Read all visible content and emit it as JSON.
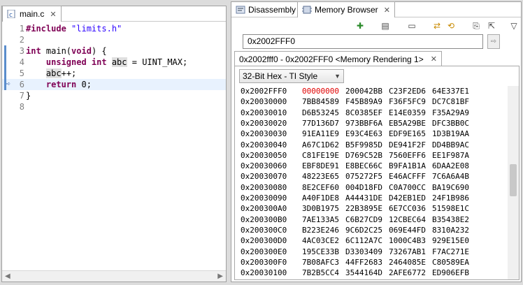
{
  "editor": {
    "tab_label": "main.c",
    "tab_icon": "c-file-icon",
    "lines": [
      {
        "num": "1",
        "parts": [
          {
            "t": "#include ",
            "c": "kw"
          },
          {
            "t": "\"limits.h\"",
            "c": "str"
          }
        ]
      },
      {
        "num": "2",
        "parts": []
      },
      {
        "num": "3",
        "parts": [
          {
            "t": "int ",
            "c": "kw"
          },
          {
            "t": "main(",
            "c": ""
          },
          {
            "t": "void",
            "c": "kw"
          },
          {
            "t": ") {",
            "c": ""
          }
        ]
      },
      {
        "num": "4",
        "parts": [
          {
            "t": "    ",
            "c": ""
          },
          {
            "t": "unsigned int ",
            "c": "kw"
          },
          {
            "t": "abc",
            "c": "hl"
          },
          {
            "t": " = UINT_MAX;",
            "c": ""
          }
        ]
      },
      {
        "num": "5",
        "parts": [
          {
            "t": "    ",
            "c": ""
          },
          {
            "t": "abc",
            "c": "hl"
          },
          {
            "t": "++;",
            "c": ""
          }
        ]
      },
      {
        "num": "6",
        "parts": [
          {
            "t": "    ",
            "c": ""
          },
          {
            "t": "return ",
            "c": "kw"
          },
          {
            "t": "0;",
            "c": ""
          }
        ]
      },
      {
        "num": "7",
        "parts": [
          {
            "t": "}",
            "c": ""
          }
        ]
      },
      {
        "num": "8",
        "parts": []
      }
    ],
    "current_line": 6
  },
  "memory": {
    "tab_disassembly": "Disassembly",
    "tab_memory_browser": "Memory Browser",
    "address_input": "0x2002FFF0",
    "rendering_tab": "0x2002fff0 - 0x2002FFF0 <Memory Rendering 1>",
    "format_select": "32-Bit Hex - TI Style",
    "rows": [
      {
        "addr": "0x2002FFF0",
        "words": [
          "00000000",
          "200042BB",
          "C23F2ED6",
          "64E337E1"
        ]
      },
      {
        "addr": "0x20030000",
        "words": [
          "7BB84589",
          "F45B89A9",
          "F36F5FC9",
          "DC7C81BF"
        ]
      },
      {
        "addr": "0x20030010",
        "words": [
          "D6B53245",
          "8C0385EF",
          "E14E0359",
          "F35A29A9"
        ]
      },
      {
        "addr": "0x20030020",
        "words": [
          "77D136D7",
          "973BBF6A",
          "EB5A29BE",
          "DFC3BB0C"
        ]
      },
      {
        "addr": "0x20030030",
        "words": [
          "91EA11E9",
          "E93C4E63",
          "EDF9E165",
          "1D3B19AA"
        ]
      },
      {
        "addr": "0x20030040",
        "words": [
          "A67C1D62",
          "B5F9985D",
          "DE941F2F",
          "DD4BB9AC"
        ]
      },
      {
        "addr": "0x20030050",
        "words": [
          "C81FE19E",
          "D769C52B",
          "7560EFF6",
          "EE1F987A"
        ]
      },
      {
        "addr": "0x20030060",
        "words": [
          "EBF8DE91",
          "E8BEC66C",
          "B9FA1B1A",
          "6DAA2E08"
        ]
      },
      {
        "addr": "0x20030070",
        "words": [
          "48223E65",
          "075272F5",
          "E46ACFFF",
          "7C6A6A4B"
        ]
      },
      {
        "addr": "0x20030080",
        "words": [
          "8E2CEF60",
          "004D18FD",
          "C0A700CC",
          "BA19C690"
        ]
      },
      {
        "addr": "0x20030090",
        "words": [
          "A40F1DE8",
          "A44431DE",
          "D42EB1ED",
          "24F1B986"
        ]
      },
      {
        "addr": "0x200300A0",
        "words": [
          "3D0B1975",
          "22B3895E",
          "6E7CC036",
          "51598E1C"
        ]
      },
      {
        "addr": "0x200300B0",
        "words": [
          "7AE133A5",
          "C6B27CD9",
          "12CBEC64",
          "B35438E2"
        ]
      },
      {
        "addr": "0x200300C0",
        "words": [
          "B223E246",
          "9C6D2C25",
          "069E44FD",
          "8310A232"
        ]
      },
      {
        "addr": "0x200300D0",
        "words": [
          "4AC03CE2",
          "6C112A7C",
          "1000C4B3",
          "929E15E0"
        ]
      },
      {
        "addr": "0x200300E0",
        "words": [
          "195CE33B",
          "D3303409",
          "73267AB1",
          "F7AC271E"
        ]
      },
      {
        "addr": "0x200300F0",
        "words": [
          "7B08AFC3",
          "44FF2683",
          "2464085E",
          "C80589EA"
        ]
      },
      {
        "addr": "0x20030100",
        "words": [
          "7B2B5CC4",
          "3544164D",
          "2AFE6772",
          "ED906EFB"
        ]
      }
    ],
    "changed_word": {
      "row": 0,
      "col": 0,
      "color": "#e00000"
    }
  }
}
